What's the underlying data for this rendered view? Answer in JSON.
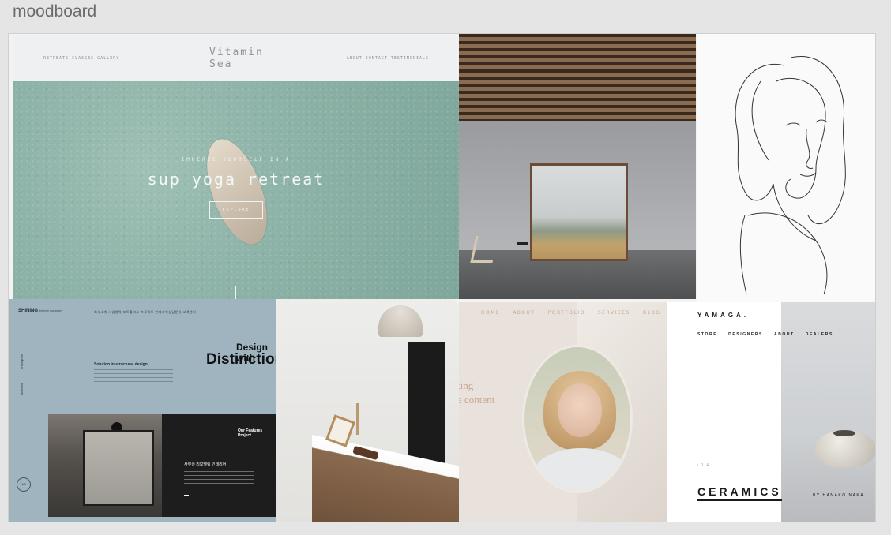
{
  "page": {
    "title": "moodboard"
  },
  "tiles": {
    "vitamin_sea": {
      "logo_line1": "Vitamin",
      "logo_line2": "Sea",
      "nav_left": "RETREATS  CLASSES  GALLERY",
      "nav_right": "ABOUT  CONTACT  TESTIMONIALS",
      "kicker": "IMMERSE YOURSELF IN A",
      "headline": "sup yoga retreat",
      "cta": "EXPLORE"
    },
    "interior": {
      "alt": "minimal room with large window"
    },
    "line_art": {
      "alt": "continuous line drawing of a face"
    },
    "shining": {
      "brand": "SHINING",
      "brand_sub": "interior company",
      "menu": "회사소개   사업영역   포트폴리오   프로젝트   인테리어상담문의   고객센터",
      "side_1": "instagram",
      "side_2": "facebook",
      "sub_title": "Solution in structural design",
      "design_with": "Design with",
      "distinction": "Distinction",
      "feat_title": "Our Features Project",
      "kor_title": "사무실 리모델링 인테리어",
      "page_ind": "1/3"
    },
    "portrait": {
      "menu": [
        "HOME",
        "ABOUT",
        "PORTFOLIO",
        "SERVICES",
        "BLOG"
      ],
      "txt1": "ting",
      "txt2": "e content"
    },
    "yamaga": {
      "logo": "YAMAGA.",
      "menu": [
        "STORE",
        "DESIGNERS",
        "ABOUT",
        "DEALERS"
      ],
      "pager": "‹   1/4   ›",
      "ceramics": "CERAMICS",
      "by": "BY HANAKO NAKA"
    }
  }
}
